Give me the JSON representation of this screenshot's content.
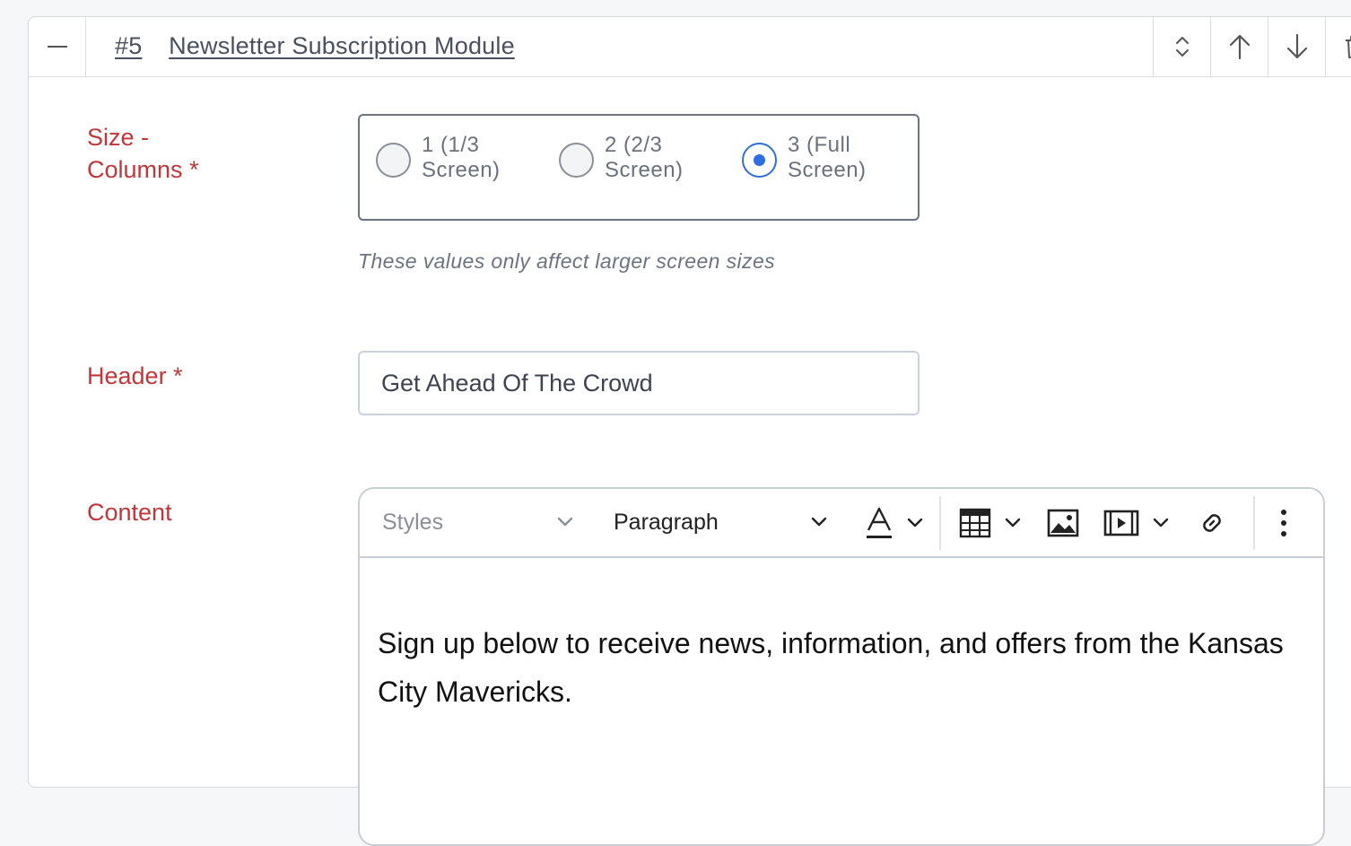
{
  "module": {
    "number": "#5",
    "title": "Newsletter Subscription Module"
  },
  "size": {
    "label": "Size -\nColumns *",
    "options": [
      {
        "label": "1 (1/3\nScreen)",
        "checked": false
      },
      {
        "label": "2 (2/3\nScreen)",
        "checked": false
      },
      {
        "label": "3 (Full\nScreen)",
        "checked": true
      }
    ],
    "hint": "These values only affect larger screen sizes"
  },
  "header": {
    "label": "Header *",
    "value": "Get Ahead Of The Crowd"
  },
  "content": {
    "label": "Content",
    "toolbar": {
      "styles": "Styles",
      "block_format": "Paragraph"
    },
    "body": "Sign up below to receive news, information, and offers from the Kansas City Mavericks."
  },
  "colors": {
    "label_red": "#c0373b",
    "radio_blue": "#2f6de1"
  }
}
